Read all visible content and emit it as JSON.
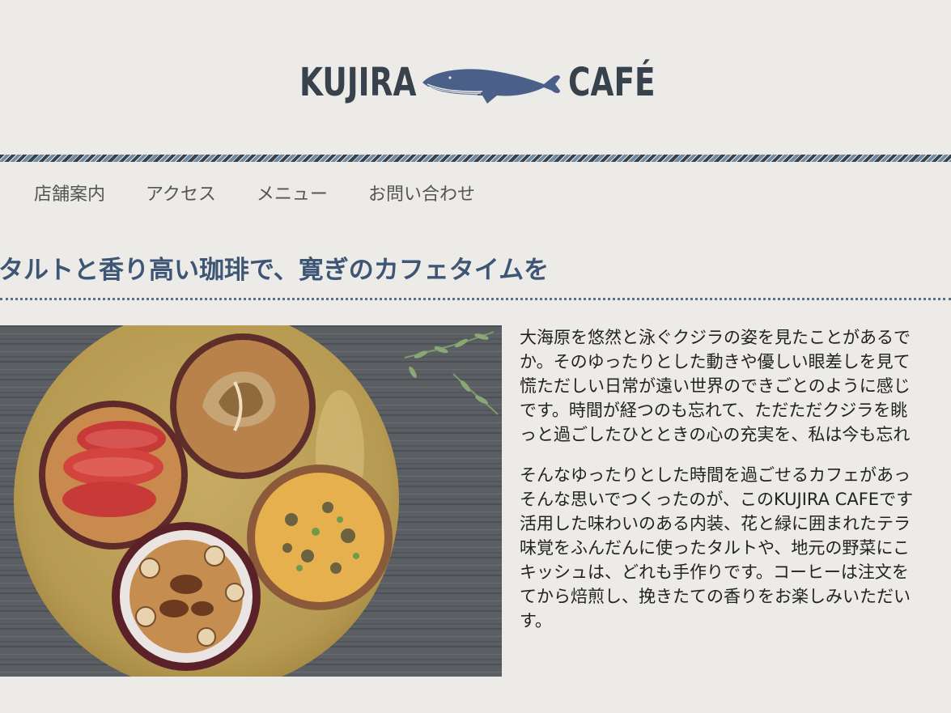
{
  "header": {
    "logo_left": "KUJIRA",
    "logo_right": "CAFÉ",
    "logo_icon": "whale-icon"
  },
  "nav": {
    "items": [
      {
        "label": "店舗案内"
      },
      {
        "label": "アクセス"
      },
      {
        "label": "メニュー"
      },
      {
        "label": "お問い合わせ"
      }
    ]
  },
  "main": {
    "headline": "タルトと香り高い珈琲で、寛ぎのカフェタイムを",
    "paragraph1": [
      "大海原を悠然と泳ぐクジラの姿を見たことがあるで",
      "か。そのゆったりとした動きや優しい眼差しを見て",
      "慌ただしい日常が遠い世界のできごとのように感じ",
      "です。時間が経つのも忘れて、ただただクジラを眺",
      "っと過ごしたひとときの心の充実を、私は今も忘れ"
    ],
    "paragraph2": [
      "そんなゆったりとした時間を過ごせるカフェがあっ",
      "そんな思いでつくったのが、このKUJIRA CAFEです",
      "活用した味わいのある内装、花と緑に囲まれたテラ",
      "味覚をふんだんに使ったタルトや、地元の野菜にこ",
      "キッシュは、どれも手作りです。コーヒーは注文を",
      "てから焙煎し、挽きたての香りをお楽しみいただい",
      "す。"
    ],
    "photo_icon": "tarts-photo"
  },
  "colors": {
    "background": "#edebe7",
    "brand_dark": "#37424d",
    "whale_blue": "#4a6088",
    "headline": "#3e5675",
    "rope_accent": "#6f8ca6"
  }
}
